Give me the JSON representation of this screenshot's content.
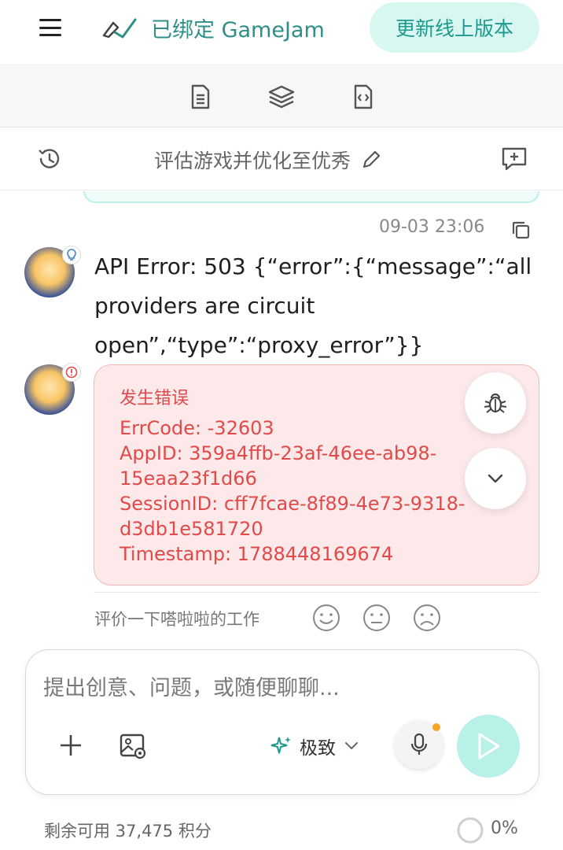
{
  "header": {
    "menu_icon": "hamburger-menu-icon",
    "bind_icon": "link-check-icon",
    "bind_status": "已绑定 GameJam",
    "update_button": "更新线上版本",
    "accent_color": "#2e8f88"
  },
  "toolbar": {
    "icons": [
      "document-icon",
      "layers-icon",
      "code-file-icon"
    ]
  },
  "session": {
    "history_icon": "history-icon",
    "title": "评估游戏并优化至优秀",
    "edit_icon": "pencil-icon",
    "new_chat_icon": "new-chat-icon"
  },
  "message": {
    "timestamp": "09-03 23:06",
    "copy_icon": "copy-icon",
    "avatar_badge_icon": "lightbulb-icon",
    "text": "API Error: 503 {“error”:{“message”:“all providers are circuit open”,“type”:“proxy_error”}}"
  },
  "error_card": {
    "avatar_badge_icon": "alert-icon",
    "title": "发生错误",
    "err_code": "ErrCode: -32603",
    "app_id_1": "AppID: 359a4ffb-23af-46ee-ab98-",
    "app_id_2": "15eaa23f1d66",
    "session_id_1": "SessionID: cff7fcae-8f89-4e73-9318-",
    "session_id_2": "d3db1e581720",
    "timestamp": "Timestamp: 1788448169674",
    "color": "#e04a4a",
    "bug_icon": "bug-icon",
    "expand_icon": "chevron-down-icon"
  },
  "rating": {
    "label": "评价一下嗒啦啦的工作",
    "faces": [
      "smile-face-icon",
      "neutral-face-icon",
      "sad-face-icon"
    ]
  },
  "composer": {
    "placeholder": "提出创意、问题，或随便聊聊...",
    "plus_icon": "plus-icon",
    "image_icon": "image-settings-icon",
    "mode_icon": "sparkle-icon",
    "mode_label": "极致",
    "mic_icon": "microphone-icon",
    "send_icon": "send-play-icon"
  },
  "footer": {
    "credits": "剩余可用 37,475 积分",
    "progress": "0%"
  }
}
